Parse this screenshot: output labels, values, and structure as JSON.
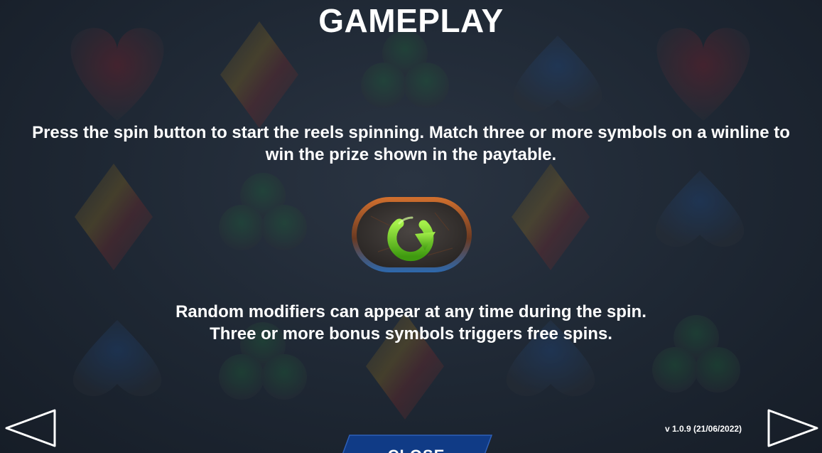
{
  "screen": {
    "title": "GAMEPLAY",
    "paragraph_1": "Press the spin button to start the reels spinning. Match three or more symbols on a winline to win the prize shown in the paytable.",
    "paragraph_2_line_1": "Random modifiers can appear at any time during the spin.",
    "paragraph_2_line_2": "Three or more bonus symbols triggers free spins.",
    "version": "v 1.0.9 (21/06/2022)"
  },
  "buttons": {
    "close_label": "CLOSE",
    "prev_icon": "left-arrow-outline",
    "next_icon": "right-arrow-outline",
    "spin_icon": "circular-arrow-green"
  },
  "colors": {
    "background": "#1e2733",
    "text": "#ffffff",
    "spin_arrow": "#6fd31b",
    "spin_frame": "#3a3634",
    "spin_border_orange": "#c9652a",
    "spin_border_blue": "#2a5f9e",
    "close_button": "#103b86"
  },
  "background_symbols": [
    "heart",
    "diamond",
    "club",
    "spade"
  ]
}
